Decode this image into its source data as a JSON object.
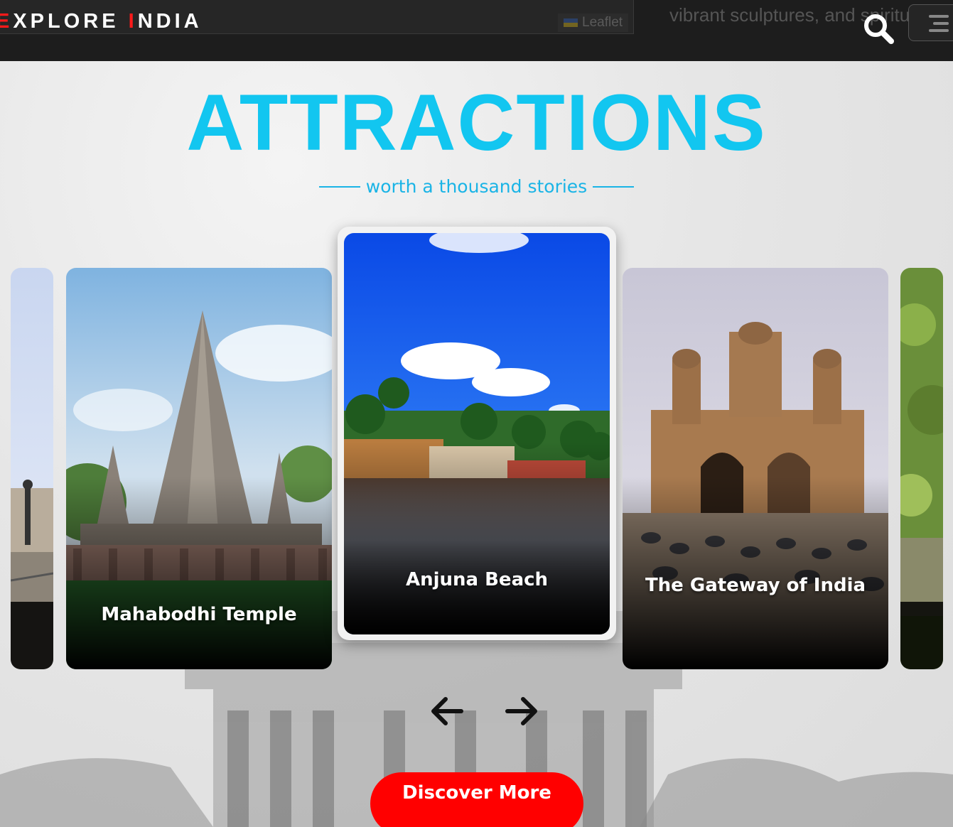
{
  "navbar": {
    "logo_first_letter": "E",
    "logo_word1_rest": "XPLORE ",
    "logo_second_letter": "I",
    "logo_word2_rest": "NDIA",
    "map_attribution": "Leaflet",
    "peek_text": "vibrant sculptures, and spiritu",
    "search_icon": "search-icon",
    "menu_icon": "hamburger-menu-icon"
  },
  "section": {
    "heading": "ATTRACTIONS",
    "subheading": "worth a thousand stories"
  },
  "carousel": {
    "cards": [
      {
        "label": "Mahabodhi Temple"
      },
      {
        "label": "Anjuna Beach"
      },
      {
        "label": "The Gateway of India"
      }
    ],
    "prev_icon": "arrow-left-icon",
    "next_icon": "arrow-right-icon"
  },
  "cta": {
    "discover_label": "Discover More"
  },
  "colors": {
    "accent": "#12c6f0",
    "brand_red": "#ff1a1a",
    "cta_red": "#ff0000",
    "navbar": "#1d1d1d"
  }
}
